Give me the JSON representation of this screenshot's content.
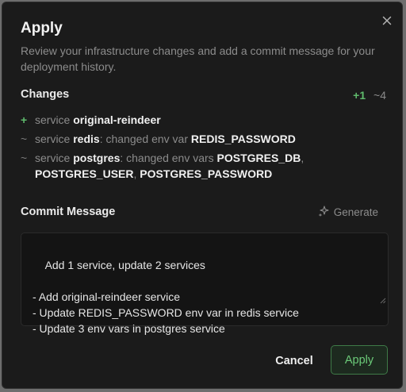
{
  "dialog": {
    "title": "Apply",
    "description": "Review your infrastructure changes and add a commit message for your deployment history.",
    "close_icon": "close-icon"
  },
  "changes": {
    "title": "Changes",
    "added_count": "+1",
    "modified_count": "~4",
    "items": [
      {
        "symbol": "+",
        "kind": "added",
        "prefix": "service ",
        "name": "original-reindeer"
      },
      {
        "symbol": "~",
        "kind": "modified",
        "prefix": "service ",
        "name": "redis",
        "middle": ": changed env var ",
        "vars": "REDIS_PASSWORD"
      },
      {
        "symbol": "~",
        "kind": "modified",
        "prefix": "service ",
        "name": "postgres",
        "middle": ": changed env vars ",
        "var1": "POSTGRES_DB",
        "sep1": ",",
        "var2": "POSTGRES_USER",
        "sep2": ", ",
        "var3": "POSTGRES_PASSWORD"
      }
    ]
  },
  "commit": {
    "title": "Commit Message",
    "generate_label": "Generate",
    "generate_icon": "sparkle-icon",
    "message": "Add 1 service, update 2 services\n\n- Add original-reindeer service\n- Update REDIS_PASSWORD env var in redis service\n- Update 3 env vars in postgres service"
  },
  "actions": {
    "cancel_label": "Cancel",
    "apply_label": "Apply"
  },
  "colors": {
    "background": "#1b1b1b",
    "accent_green": "#5fba6c",
    "muted_text": "#8c8c8c"
  }
}
